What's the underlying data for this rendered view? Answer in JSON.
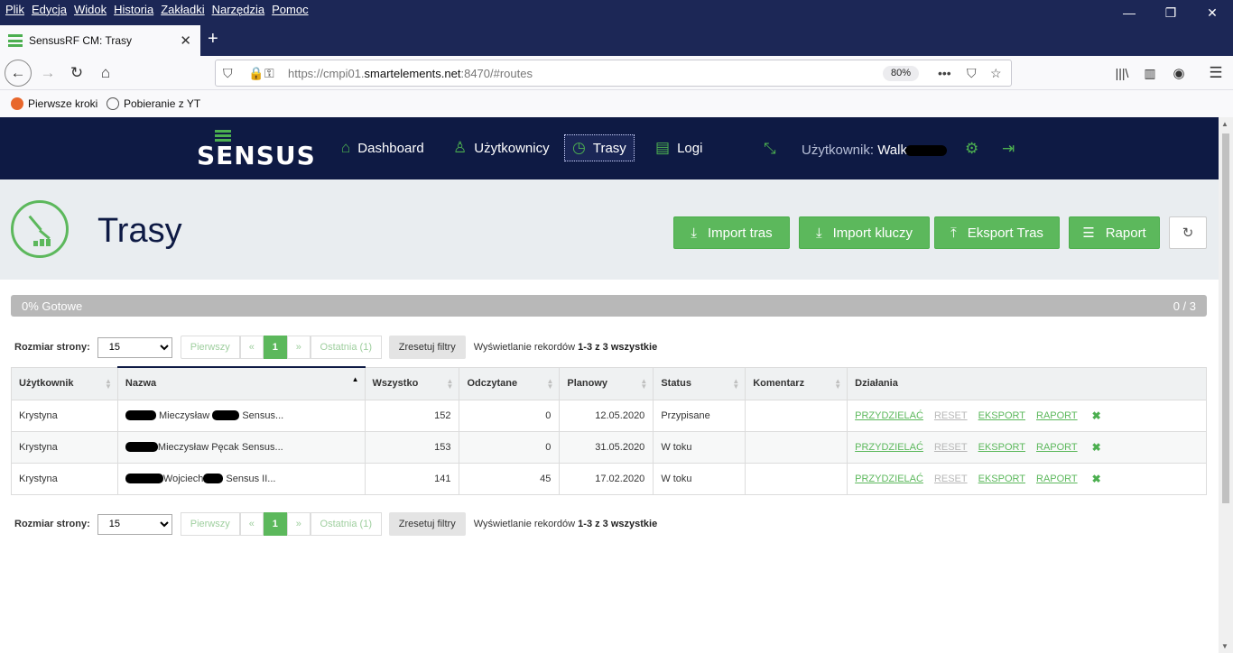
{
  "browser": {
    "menus": [
      "Plik",
      "Edycja",
      "Widok",
      "Historia",
      "Zakładki",
      "Narzędzia",
      "Pomoc"
    ],
    "tab_title": "SensusRF CM: Trasy",
    "url_prefix": "https://cmpi01.",
    "url_domain": "smartelements.net",
    "url_suffix": ":8470/#routes",
    "zoom": "80%",
    "bookmarks": [
      "Pierwsze kroki",
      "Pobieranie z YT"
    ]
  },
  "app": {
    "logo": "SENSUS",
    "nav": [
      "Dashboard",
      "Użytkownicy",
      "Trasy",
      "Logi"
    ],
    "user_label": "Użytkownik:",
    "user_name": "Walk",
    "page_title": "Trasy",
    "buttons": [
      "Import tras",
      "Import kluczy",
      "Eksport Tras",
      "Raport"
    ],
    "progress_label": "0% Gotowe",
    "progress_count": "0 / 3",
    "progress_fraction": 0,
    "pager": {
      "label": "Rozmiar strony:",
      "size": "15",
      "first": "Pierwszy",
      "prev": "«",
      "current": "1",
      "next": "»",
      "last": "Ostatnia (1)",
      "reset": "Zresetuj filtry",
      "info_prefix": "Wyświetlanie rekordów",
      "info_range": "1-3 z 3 wszystkie"
    },
    "table": {
      "columns": [
        "Użytkownik",
        "Nazwa",
        "Wszystko",
        "Odczytane",
        "Planowy",
        "Status",
        "Komentarz",
        "Działania"
      ],
      "rows": [
        {
          "user": "Krystyna",
          "name_a": "Mieczysław",
          "name_b": "Sensus...",
          "all": "152",
          "read": "0",
          "planned": "12.05.2020",
          "status": "Przypisane",
          "comment": ""
        },
        {
          "user": "Krystyna",
          "name_a": "Mieczysław Pęcak Sensus...",
          "name_b": "",
          "all": "153",
          "read": "0",
          "planned": "31.05.2020",
          "status": "W toku",
          "comment": ""
        },
        {
          "user": "Krystyna",
          "name_a": "Wojciech",
          "name_b": "Sensus II...",
          "all": "141",
          "read": "45",
          "planned": "17.02.2020",
          "status": "W toku",
          "comment": ""
        }
      ],
      "actions": [
        "PRZYDZIELAĆ",
        "RESET",
        "EKSPORT",
        "RAPORT"
      ]
    }
  }
}
